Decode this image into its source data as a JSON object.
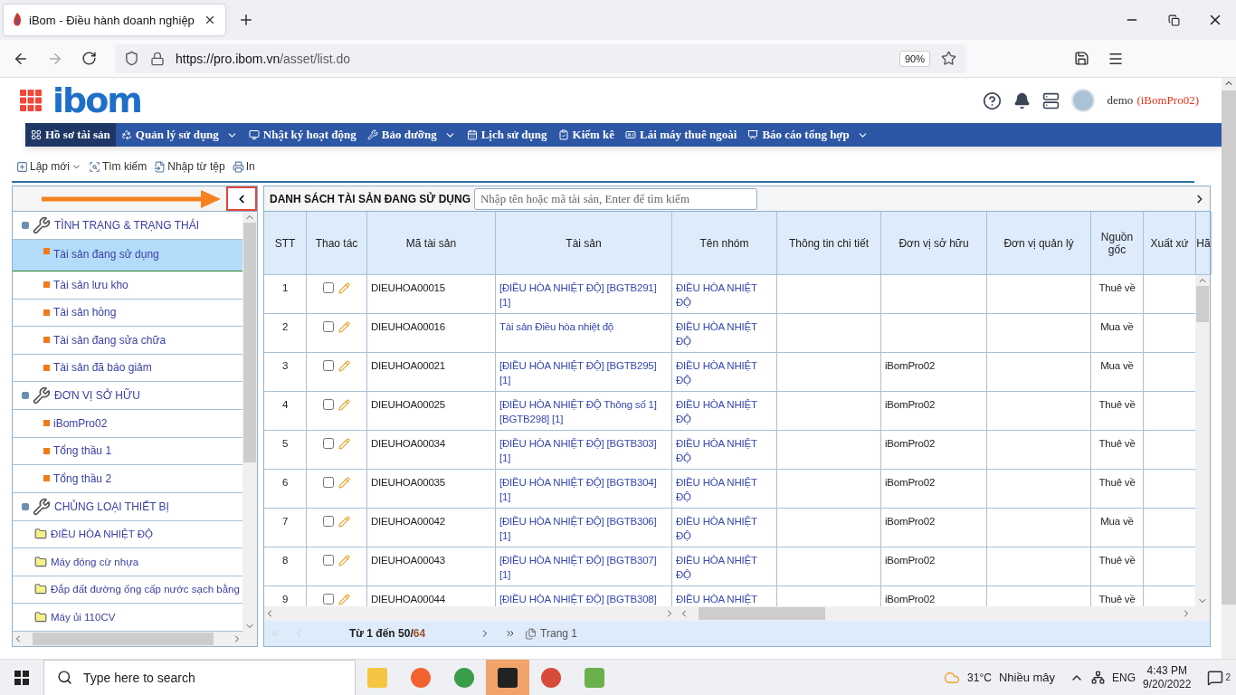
{
  "browser": {
    "tab_title": "iBom - Điều hành doanh nghiệp",
    "url_host": "https://pro.ibom.vn",
    "url_path": "/asset/list.do",
    "zoom": "90%"
  },
  "header": {
    "logo": "ibom",
    "user": "demo",
    "company": "(iBomPro02)"
  },
  "nav": [
    {
      "label": "Hồ sơ tài sản",
      "selected": true,
      "dropdown": false
    },
    {
      "label": "Quản lý sử dụng",
      "selected": false,
      "dropdown": true
    },
    {
      "label": "Nhật ký hoạt động",
      "selected": false,
      "dropdown": false
    },
    {
      "label": "Bảo dưỡng",
      "selected": false,
      "dropdown": true
    },
    {
      "label": "Lịch sử dụng",
      "selected": false,
      "dropdown": false
    },
    {
      "label": "Kiểm kê",
      "selected": false,
      "dropdown": false
    },
    {
      "label": "Lái máy thuê ngoài",
      "selected": false,
      "dropdown": false
    },
    {
      "label": "Báo cáo tổng hợp",
      "selected": false,
      "dropdown": true
    }
  ],
  "toolbar": [
    {
      "label": "Lập mới",
      "dropdown": true
    },
    {
      "label": "Tìm kiếm",
      "dropdown": false
    },
    {
      "label": "Nhập từ tệp",
      "dropdown": false
    },
    {
      "label": "In",
      "dropdown": false
    }
  ],
  "sidebar": {
    "groups": [
      {
        "label": "TÌNH TRẠNG & TRẠNG THÁI",
        "expanded": true,
        "children": [
          {
            "label": "Tài sản đang sử dụng",
            "kind": "status",
            "selected": true
          },
          {
            "label": "Tài sản lưu kho",
            "kind": "status",
            "selected": false
          },
          {
            "label": "Tài sản hỏng",
            "kind": "status",
            "selected": false
          },
          {
            "label": "Tài sản đang sửa chữa",
            "kind": "status",
            "selected": false
          },
          {
            "label": "Tài sản đã báo giảm",
            "kind": "status",
            "selected": false
          }
        ]
      },
      {
        "label": "ĐƠN VỊ SỞ HỮU",
        "expanded": true,
        "children": [
          {
            "label": "iBomPro02",
            "kind": "status",
            "selected": false
          },
          {
            "label": "Tổng thầu 1",
            "kind": "status",
            "selected": false
          },
          {
            "label": "Tổng thầu 2",
            "kind": "status",
            "selected": false
          }
        ]
      },
      {
        "label": "CHỦNG LOẠI THIẾT BỊ",
        "expanded": true,
        "children": [
          {
            "label": "ĐIỀU HÒA NHIỆT ĐỘ",
            "kind": "folder",
            "selected": false
          },
          {
            "label": "Máy đóng cừ nhựa",
            "kind": "folder",
            "selected": false
          },
          {
            "label": "Đắp đất đường ống cấp nước sạch bằng",
            "kind": "folder",
            "selected": false
          },
          {
            "label": "Máy ủi 110CV",
            "kind": "folder",
            "selected": false
          }
        ]
      }
    ]
  },
  "list": {
    "title": "DANH SÁCH TÀI SẢN ĐANG SỬ DỤNG",
    "search": {
      "placeholder": "Nhập tên hoặc mã tài sản, Enter để tìm kiếm"
    },
    "columns": [
      "STT",
      "Thao tác",
      "Mã tài sản",
      "Tài sản",
      "Tên nhóm",
      "Thông tin chi tiết",
      "Đơn vị sở hữu",
      "Đơn vị quản lý",
      "Nguồn gốc",
      "Xuất xứ",
      "Hã"
    ],
    "rows": [
      {
        "stt": "1",
        "checked": false,
        "code": "DIEUHOA00015",
        "asset": "[ĐIỀU HÒA NHIỆT ĐỘ] [BGTB291] [1]",
        "group": "ĐIỀU HÒA NHIỆT ĐỘ",
        "origin": "Thuê về"
      },
      {
        "stt": "2",
        "checked": false,
        "code": "DIEUHOA00016",
        "asset": "Tài sản Điều hòa nhiệt độ",
        "group": "ĐIỀU HÒA NHIỆT ĐỘ",
        "origin": "Mua về"
      },
      {
        "stt": "3",
        "checked": false,
        "code": "DIEUHOA00021",
        "asset": "[ĐIỀU HÒA NHIỆT ĐỘ] [BGTB295] [1]",
        "group": "ĐIỀU HÒA NHIỆT ĐỘ",
        "owner": "iBomPro02",
        "origin": "Mua về"
      },
      {
        "stt": "4",
        "checked": false,
        "code": "DIEUHOA00025",
        "asset": "[ĐIỀU HÒA NHIỆT ĐỘ Thông số 1] [BGTB298] [1]",
        "group": "ĐIỀU HÒA NHIỆT ĐỘ",
        "owner": "iBomPro02",
        "origin": "Thuê về"
      },
      {
        "stt": "5",
        "checked": false,
        "code": "DIEUHOA00034",
        "asset": "[ĐIỀU HÒA NHIỆT ĐỘ] [BGTB303] [1]",
        "group": "ĐIỀU HÒA NHIỆT ĐỘ",
        "owner": "iBomPro02",
        "origin": "Thuê về"
      },
      {
        "stt": "6",
        "checked": false,
        "code": "DIEUHOA00035",
        "asset": "[ĐIỀU HÒA NHIỆT ĐỘ] [BGTB304] [1]",
        "group": "ĐIỀU HÒA NHIỆT ĐỘ",
        "owner": "iBomPro02",
        "origin": "Thuê về"
      },
      {
        "stt": "7",
        "checked": false,
        "code": "DIEUHOA00042",
        "asset": "[ĐIỀU HÒA NHIỆT ĐỘ] [BGTB306] [1]",
        "group": "ĐIỀU HÒA NHIỆT ĐỘ",
        "owner": "iBomPro02",
        "origin": "Mua về"
      },
      {
        "stt": "8",
        "checked": false,
        "code": "DIEUHOA00043",
        "asset": "[ĐIỀU HÒA NHIỆT ĐỘ] [BGTB307] [1]",
        "group": "ĐIỀU HÒA NHIỆT ĐỘ",
        "owner": "iBomPro02",
        "origin": "Thuê về"
      },
      {
        "stt": "9",
        "checked": false,
        "code": "DIEUHOA00044",
        "asset": "[ĐIỀU HÒA NHIỆT ĐỘ] [BGTB308]",
        "group": "ĐIỀU HÒA NHIỆT",
        "owner": "iBomPro02",
        "origin": "Thuê về"
      }
    ],
    "pager": {
      "range": "Từ 1 đến 50/",
      "total": "64",
      "page": "Trang 1"
    }
  },
  "taskbar": {
    "search_placeholder": "Type here to search",
    "temperature": "31°C",
    "weather": "Nhiều mây",
    "language": "ENG",
    "time": "4:43 PM",
    "date": "9/20/2022",
    "notifications": "2"
  }
}
